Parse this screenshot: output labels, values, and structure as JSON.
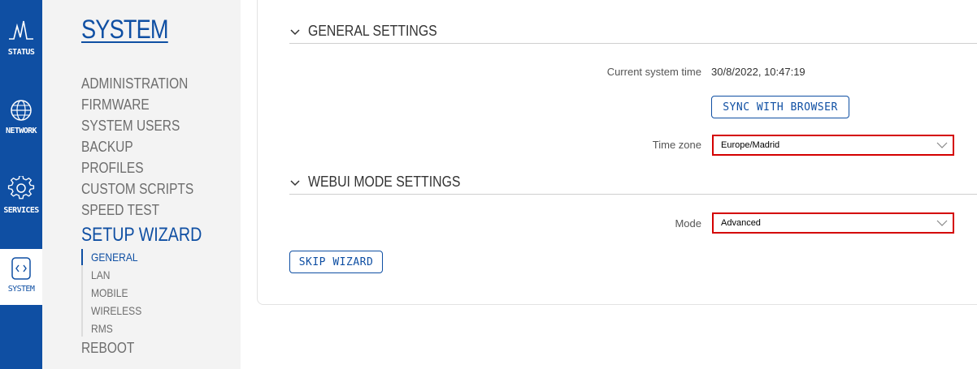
{
  "nav_rail": {
    "items": [
      {
        "label": "STATUS",
        "icon": "status-pulse-icon",
        "active": false
      },
      {
        "label": "NETWORK",
        "icon": "globe-icon",
        "active": false
      },
      {
        "label": "SERVICES",
        "icon": "gear-icon",
        "active": false
      },
      {
        "label": "SYSTEM",
        "icon": "code-brackets-icon",
        "active": true
      }
    ],
    "accent_color": "#0f4fa3"
  },
  "menu": {
    "title": "SYSTEM",
    "items": [
      {
        "label": "ADMINISTRATION"
      },
      {
        "label": "FIRMWARE"
      },
      {
        "label": "SYSTEM USERS"
      },
      {
        "label": "BACKUP"
      },
      {
        "label": "PROFILES"
      },
      {
        "label": "CUSTOM SCRIPTS"
      },
      {
        "label": "SPEED TEST"
      },
      {
        "label": "SETUP WIZARD",
        "active": true
      },
      {
        "label": "REBOOT"
      }
    ],
    "submenu": [
      {
        "label": "GENERAL",
        "active": true
      },
      {
        "label": "LAN"
      },
      {
        "label": "MOBILE"
      },
      {
        "label": "WIRELESS"
      },
      {
        "label": "RMS"
      }
    ]
  },
  "general_settings": {
    "title": "GENERAL SETTINGS",
    "time_label": "Current system time",
    "time_value": "30/8/2022, 10:47:19",
    "sync_button": "SYNC WITH BROWSER",
    "timezone_label": "Time zone",
    "timezone_value": "Europe/Madrid"
  },
  "webui_settings": {
    "title": "WEBUI MODE SETTINGS",
    "mode_label": "Mode",
    "mode_value": "Advanced"
  },
  "skip_button": "SKIP WIZARD",
  "highlight_color": "#d40000"
}
